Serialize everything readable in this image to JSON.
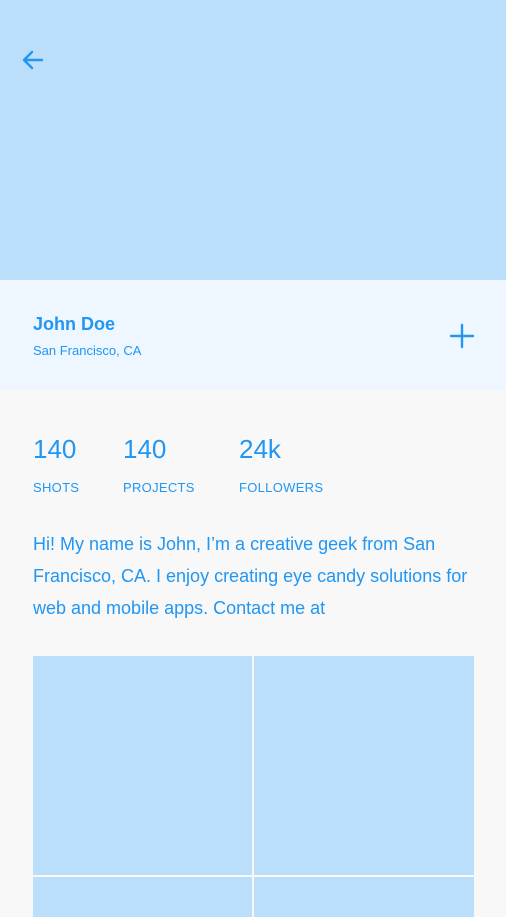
{
  "profile": {
    "name": "John Doe",
    "location": "San Francisco, CA",
    "bio": "Hi! My name is John, I’m a creative geek from San Francisco, CA. I enjoy creating eye candy solutions for web and mobile apps. Contact me at"
  },
  "stats": [
    {
      "value": "140",
      "label": "SHOTS"
    },
    {
      "value": "140",
      "label": "PROJECTS"
    },
    {
      "value": "24k",
      "label": "FOLLOWERS"
    }
  ],
  "icons": {
    "back": "arrow-left-icon",
    "add": "plus-icon"
  },
  "colors": {
    "accent": "#2196f3",
    "cover": "#bbdefb",
    "header_card": "#eef7ff",
    "background": "#f8f8f8"
  }
}
